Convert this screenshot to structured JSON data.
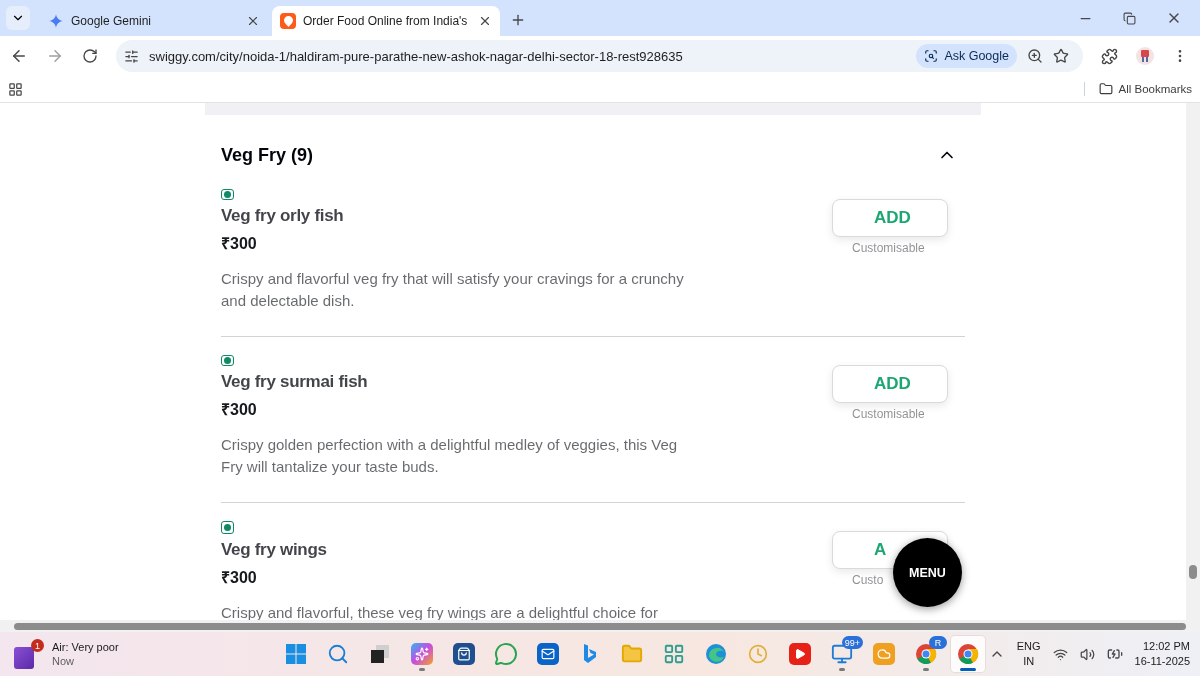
{
  "browser": {
    "tabs": [
      {
        "title": "Google Gemini",
        "kind": "gemini",
        "selected": false
      },
      {
        "title": "Order Food Online from India's",
        "kind": "swiggy",
        "selected": true
      }
    ],
    "url": "swiggy.com/city/noida-1/haldiram-pure-parathe-new-ashok-nagar-delhi-sector-18-rest928635",
    "ask_google": "Ask Google",
    "bookmarks": "All Bookmarks"
  },
  "section": {
    "title": "Veg Fry (9)",
    "expanded": true
  },
  "items": [
    {
      "veg": true,
      "name": "Veg fry orly fish",
      "price": "₹300",
      "description": "Crispy and flavorful veg fry that will satisfy your cravings for a crunchy and delectable dish.",
      "add": "ADD",
      "note": "Customisable"
    },
    {
      "veg": true,
      "name": "Veg fry surmai fish",
      "price": "₹300",
      "description": "Crispy golden perfection with a delightful medley of veggies, this Veg Fry will tantalize your taste buds.",
      "add": "ADD",
      "note": "Customisable"
    },
    {
      "veg": true,
      "name": "Veg fry wings",
      "price": "₹300",
      "description": "Crispy and flavorful, these veg fry wings are a delightful choice for",
      "add": "A",
      "note": "Custo"
    }
  ],
  "menu_button": "MENU",
  "taskbar": {
    "notification": {
      "badge": "1",
      "title": "Air: Very poor",
      "time": "Now"
    },
    "apps": [
      {
        "kind": "start",
        "running": false,
        "selected": false
      },
      {
        "kind": "search",
        "running": false,
        "selected": false
      },
      {
        "kind": "taskview",
        "running": false,
        "selected": false
      },
      {
        "kind": "copilot",
        "running": true,
        "selected": false
      },
      {
        "kind": "store",
        "running": false,
        "selected": false
      },
      {
        "kind": "whatsapp",
        "running": false,
        "selected": false
      },
      {
        "kind": "outlook",
        "running": false,
        "selected": false
      },
      {
        "kind": "bing",
        "running": false,
        "selected": false
      },
      {
        "kind": "folder",
        "running": false,
        "selected": false
      },
      {
        "kind": "phone",
        "running": false,
        "selected": false
      },
      {
        "kind": "edge",
        "running": false,
        "selected": false
      },
      {
        "kind": "clock",
        "running": false,
        "selected": false
      },
      {
        "kind": "youtube",
        "running": false,
        "selected": false
      },
      {
        "kind": "chat",
        "running": true,
        "selected": false,
        "badge": "99+"
      },
      {
        "kind": "weather",
        "running": false,
        "selected": false
      },
      {
        "kind": "chrome",
        "running": true,
        "selected": false,
        "badge": "R"
      },
      {
        "kind": "chrome",
        "running": true,
        "selected": true
      }
    ],
    "language": "ENG",
    "region": "IN",
    "time": "12:02 PM",
    "date": "16-11-2025"
  }
}
